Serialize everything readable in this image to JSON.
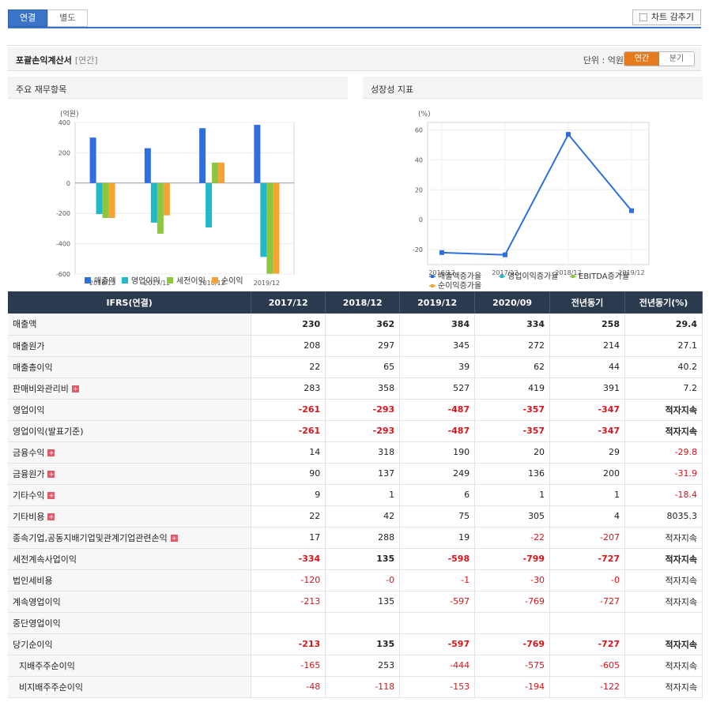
{
  "tabs": [
    "연결",
    "별도"
  ],
  "hide_chart_label": "차트 감추기",
  "section": {
    "title": "포괄손익계산서",
    "sub": "[연간]",
    "unit": "단위 : 억원",
    "period_tabs": [
      "연간",
      "분기"
    ]
  },
  "panels": {
    "left_title": "주요 재무항목",
    "right_title": "성장성 지표"
  },
  "bar_chart": {
    "ylabel": "(억원)",
    "categories": [
      "2016/12",
      "2017/12",
      "2018/12",
      "2019/12"
    ],
    "yticks": [
      "400",
      "200",
      "0",
      "-200",
      "-400",
      "-600"
    ],
    "legend": [
      "매출액",
      "영업이익",
      "세전이익",
      "순이익"
    ]
  },
  "line_chart": {
    "ylabel": "(%)",
    "categories": [
      "2016/12",
      "2017/12",
      "2018/12",
      "2019/12"
    ],
    "yticks": [
      "60",
      "40",
      "20",
      "0",
      "-20"
    ],
    "legend": [
      "매출액증가율",
      "영업이익증가율",
      "EBITDA증가율",
      "순이익증가율"
    ]
  },
  "chart_data": [
    {
      "type": "bar",
      "categories": [
        "2016/12",
        "2017/12",
        "2018/12",
        "2019/12"
      ],
      "ylabel": "(억원)",
      "ylim": [
        -600,
        400
      ],
      "series": [
        {
          "name": "매출액",
          "values": [
            300,
            230,
            362,
            384
          ],
          "color": "#2e6fe0"
        },
        {
          "name": "영업이익",
          "values": [
            -205,
            -261,
            -293,
            -487
          ],
          "color": "#22b7c9"
        },
        {
          "name": "세전이익",
          "values": [
            -230,
            -334,
            135,
            -598
          ],
          "color": "#8dc63f"
        },
        {
          "name": "순이익",
          "values": [
            -230,
            -213,
            135,
            -597
          ],
          "color": "#f7a234"
        }
      ]
    },
    {
      "type": "line",
      "categories": [
        "2016/12",
        "2017/12",
        "2018/12",
        "2019/12"
      ],
      "ylabel": "(%)",
      "ylim": [
        -30,
        65
      ],
      "series": [
        {
          "name": "매출액증가율",
          "values": [
            -22,
            -23.5,
            57,
            6
          ],
          "color": "#2e6fe0"
        }
      ]
    }
  ],
  "table": {
    "headers": [
      "IFRS(연결)",
      "2017/12",
      "2018/12",
      "2019/12",
      "2020/09",
      "전년동기",
      "전년동기(%)"
    ],
    "rows": [
      {
        "label": "매출액",
        "vals": [
          "230",
          "362",
          "384",
          "334",
          "258",
          "29.4"
        ],
        "bold": true,
        "plus": false
      },
      {
        "label": "매출원가",
        "vals": [
          "208",
          "297",
          "345",
          "272",
          "214",
          "27.1"
        ],
        "bold": false,
        "plus": false
      },
      {
        "label": "매출총이익",
        "vals": [
          "22",
          "65",
          "39",
          "62",
          "44",
          "40.2"
        ],
        "bold": false,
        "plus": false
      },
      {
        "label": "판매비와관리비",
        "vals": [
          "283",
          "358",
          "527",
          "419",
          "391",
          "7.2"
        ],
        "bold": false,
        "plus": true
      },
      {
        "label": "영업이익",
        "vals": [
          "-261",
          "-293",
          "-487",
          "-357",
          "-347",
          "적자지속"
        ],
        "bold": true,
        "plus": false
      },
      {
        "label": "영업이익(발표기준)",
        "vals": [
          "-261",
          "-293",
          "-487",
          "-357",
          "-347",
          "적자지속"
        ],
        "bold": true,
        "plus": false
      },
      {
        "label": "금융수익",
        "vals": [
          "14",
          "318",
          "190",
          "20",
          "29",
          "-29.8"
        ],
        "bold": false,
        "plus": true
      },
      {
        "label": "금융원가",
        "vals": [
          "90",
          "137",
          "249",
          "136",
          "200",
          "-31.9"
        ],
        "bold": false,
        "plus": true
      },
      {
        "label": "기타수익",
        "vals": [
          "9",
          "1",
          "6",
          "1",
          "1",
          "-18.4"
        ],
        "bold": false,
        "plus": true
      },
      {
        "label": "기타비용",
        "vals": [
          "22",
          "42",
          "75",
          "305",
          "4",
          "8035.3"
        ],
        "bold": false,
        "plus": true
      },
      {
        "label": "종속기업,공동지배기업및관계기업관련손익",
        "vals": [
          "17",
          "288",
          "19",
          "-22",
          "-207",
          "적자지속"
        ],
        "bold": false,
        "plus": true
      },
      {
        "label": "세전계속사업이익",
        "vals": [
          "-334",
          "135",
          "-598",
          "-799",
          "-727",
          "적자지속"
        ],
        "bold": true,
        "plus": false
      },
      {
        "label": "법인세비용",
        "vals": [
          "-120",
          "-0",
          "-1",
          "-30",
          "-0",
          "적자지속"
        ],
        "bold": false,
        "plus": false
      },
      {
        "label": "계속영업이익",
        "vals": [
          "-213",
          "135",
          "-597",
          "-769",
          "-727",
          "적자지속"
        ],
        "bold": false,
        "plus": false
      },
      {
        "label": "중단영업이익",
        "vals": [
          "",
          "",
          "",
          "",
          "",
          ""
        ],
        "bold": false,
        "plus": false
      },
      {
        "label": "당기순이익",
        "vals": [
          "-213",
          "135",
          "-597",
          "-769",
          "-727",
          "적자지속"
        ],
        "bold": true,
        "plus": false
      },
      {
        "label": "지배주주순이익",
        "vals": [
          "-165",
          "253",
          "-444",
          "-575",
          "-605",
          "적자지속"
        ],
        "bold": false,
        "plus": false,
        "indent": true
      },
      {
        "label": "비지배주주순이익",
        "vals": [
          "-48",
          "-118",
          "-153",
          "-194",
          "-122",
          "적자지속"
        ],
        "bold": false,
        "plus": false,
        "indent": true
      }
    ]
  }
}
